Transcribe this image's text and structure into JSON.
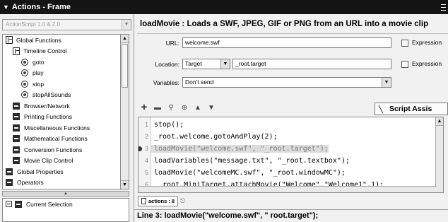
{
  "panel": {
    "title": "Actions - Frame",
    "collapse_glyph": "▼"
  },
  "left": {
    "version_select": "ActionScript 1.0 & 2.0",
    "tree": [
      {
        "label": "Global Functions",
        "icon": "book-icon",
        "indent": 0
      },
      {
        "label": "Timeline Control",
        "icon": "book-icon",
        "indent": 1
      },
      {
        "label": "goto",
        "icon": "action-icon",
        "indent": 2
      },
      {
        "label": "play",
        "icon": "action-icon",
        "indent": 2
      },
      {
        "label": "stop",
        "icon": "action-icon",
        "indent": 2
      },
      {
        "label": "stopAllSounds",
        "icon": "action-icon",
        "indent": 2
      },
      {
        "label": "Browser/Network",
        "icon": "category-icon",
        "indent": 1
      },
      {
        "label": "Printing Functions",
        "icon": "category-icon",
        "indent": 1
      },
      {
        "label": "Miscellaneous Functions",
        "icon": "category-icon",
        "indent": 1
      },
      {
        "label": "Mathematical Functions",
        "icon": "category-icon",
        "indent": 1
      },
      {
        "label": "Conversion Functions",
        "icon": "category-icon",
        "indent": 1
      },
      {
        "label": "Movie Clip Control",
        "icon": "category-icon",
        "indent": 1
      },
      {
        "label": "Global Properties",
        "icon": "category-icon",
        "indent": 0
      },
      {
        "label": "Operators",
        "icon": "category-icon",
        "indent": 0
      }
    ],
    "selection": {
      "label": "Current Selection"
    }
  },
  "right": {
    "heading": "loadMovie : Loads a SWF, JPEG, GIF or PNG from an URL into a movie clip",
    "url": {
      "label": "URL:",
      "value": "welcome.swf",
      "expression_label": "Expression"
    },
    "location": {
      "label": "Location:",
      "type": "Target",
      "value": "_root.target",
      "expression_label": "Expression"
    },
    "variables": {
      "label": "Variables:",
      "value": "Don't send"
    },
    "script_assist": "Script Assis",
    "code": [
      {
        "n": "1",
        "text": "stop();"
      },
      {
        "n": "2",
        "text": "_root.welcome.gotoAndPlay(2);"
      },
      {
        "n": "3",
        "text": "loadMovie(\"welcome.swf\", \"_root.target\");",
        "highlight": true
      },
      {
        "n": "4",
        "text": "loadVariables(\"message.txt\", \"_root.textbox\");"
      },
      {
        "n": "5",
        "text": "loadMovie(\"welcomeMC.swf\", \"_root.windowMC\");"
      },
      {
        "n": "6",
        "text": " _root.MiniTarget.attachMovie(\"Welcome\",\"Welcome1\",1);"
      }
    ],
    "tab": "actions : 8",
    "status": "Line 3: loadMovie(\"welcome.swf\", \" root.target\");"
  }
}
